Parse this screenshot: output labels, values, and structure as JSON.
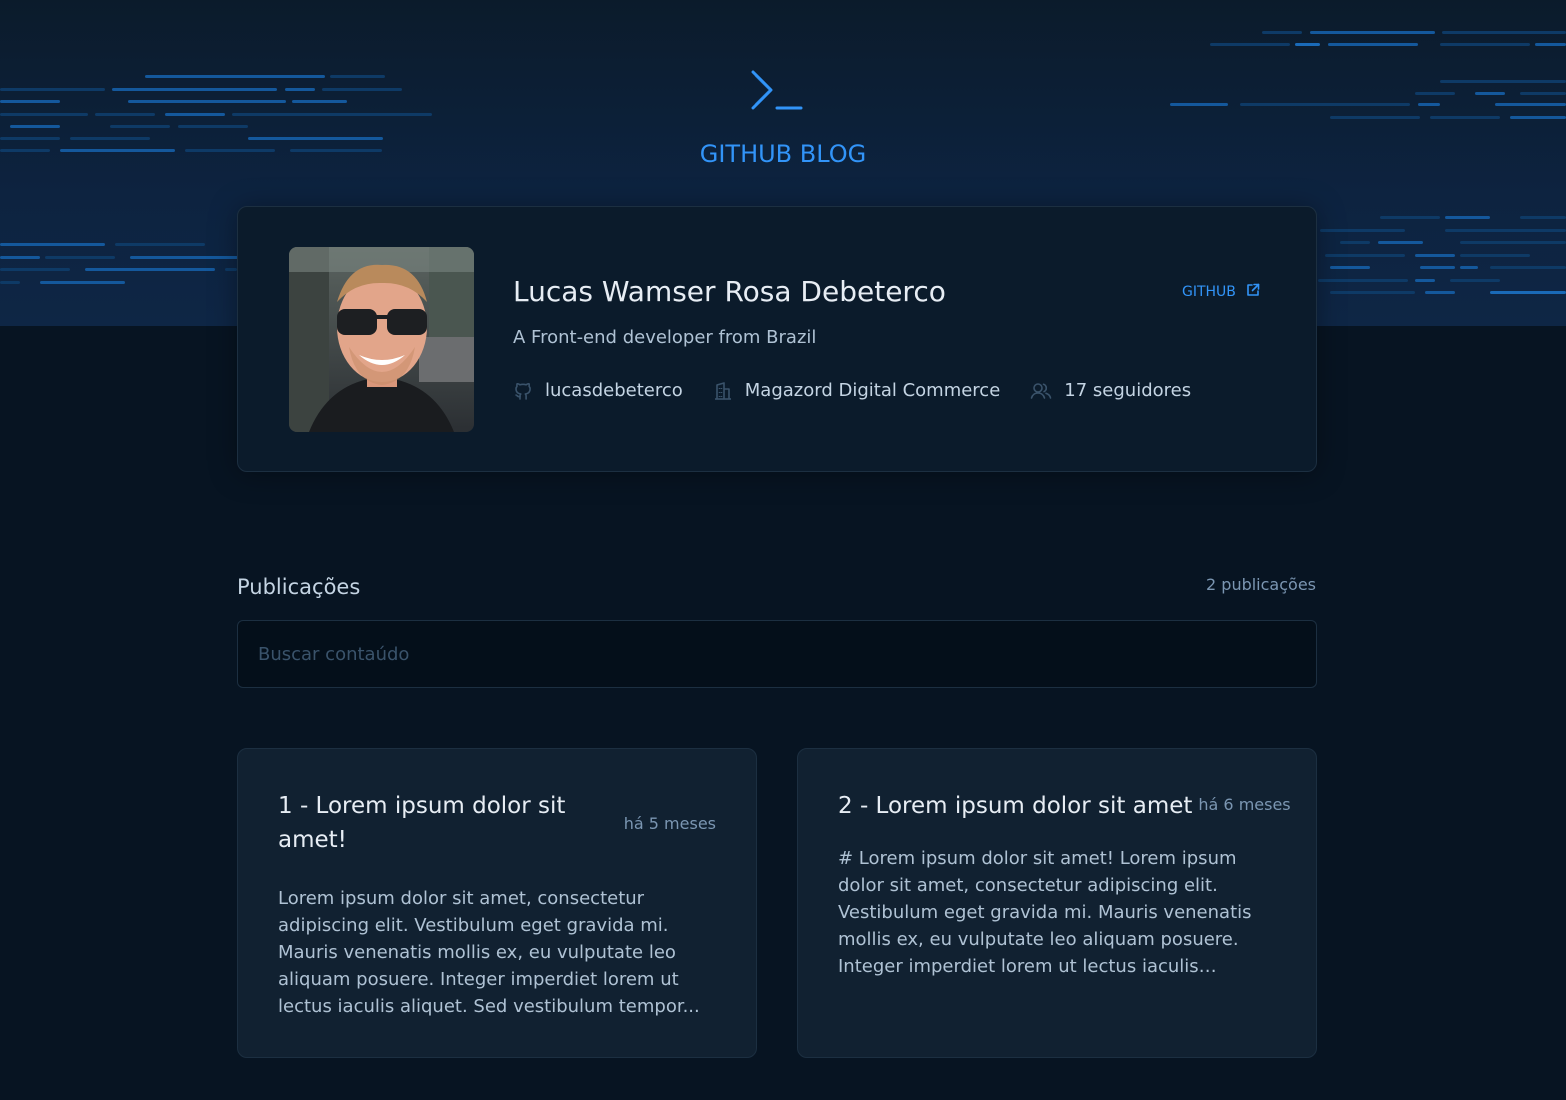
{
  "header": {
    "brand": "GITHUB BLOG",
    "logo_icon": "terminal-prompt-icon",
    "accent_color": "#3294F8"
  },
  "profile": {
    "name": "Lucas Wamser Rosa Debeterco",
    "bio": "A Front-end developer from Brazil",
    "github_link_label": "GITHUB",
    "github_link_icon": "external-link-icon",
    "username": "lucasdebeterco",
    "company": "Magazord Digital Commerce",
    "followers": "17 seguidores",
    "username_icon": "github-icon",
    "company_icon": "building-icon",
    "followers_icon": "users-icon"
  },
  "publications": {
    "title": "Publicações",
    "count": "2 publicações",
    "search_placeholder": "Buscar contaúdo",
    "search_value": ""
  },
  "posts": [
    {
      "title": "1 - Lorem ipsum dolor sit amet!",
      "date": "há 5 meses",
      "excerpt": "Lorem ipsum dolor sit amet, consectetur adipiscing elit. Vestibulum eget gravida mi. Mauris venenatis mollis ex, eu vulputate leo aliquam posuere. Integer imperdiet lorem ut lectus iaculis aliquet. Sed vestibulum tempor..."
    },
    {
      "title": "2 - Lorem ipsum dolor sit amet",
      "date": "há 6 meses",
      "excerpt": "# Lorem ipsum dolor sit amet! Lorem ipsum dolor sit amet, consectetur adipiscing elit. Vestibulum eget gravida mi. Mauris venenatis mollis ex, eu vulputate leo aliquam posuere. Integer imperdiet lorem ut lectus iaculis aliquet..."
    }
  ]
}
